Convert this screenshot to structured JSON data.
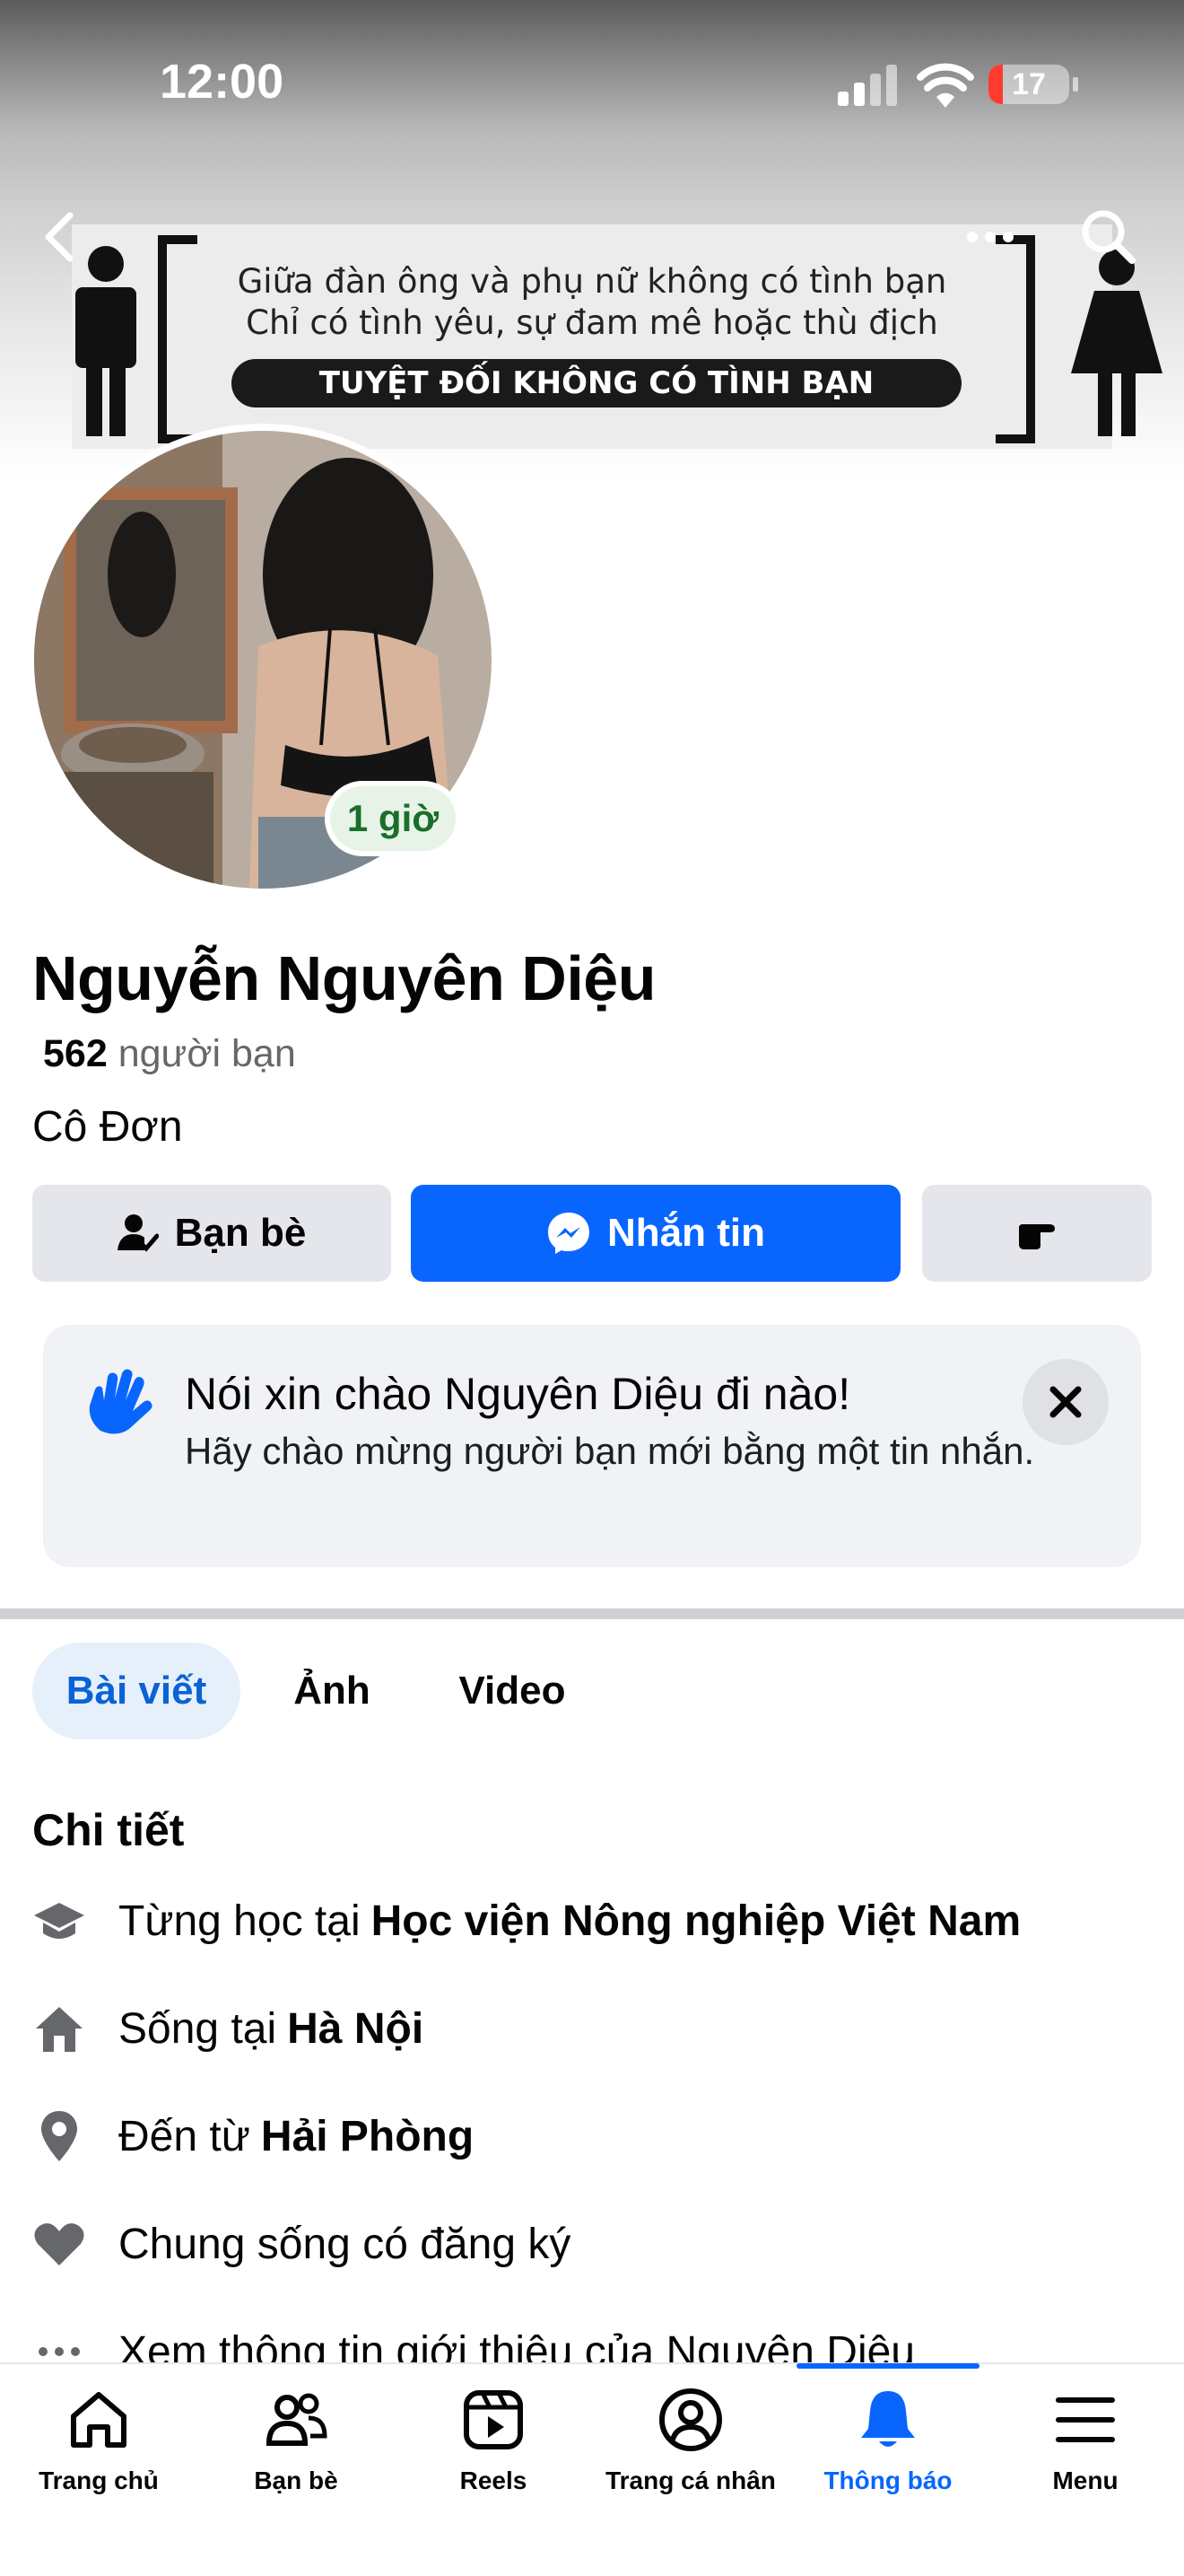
{
  "status_bar": {
    "time": "12:00",
    "battery": "17"
  },
  "cover": {
    "line1": "Giữa đàn ông và phụ nữ không có tình bạn",
    "line2": "Chỉ có tình yêu, sự đam mê hoặc thù địch",
    "banner": "TUYỆT ĐỐI KHÔNG CÓ TÌNH BẠN"
  },
  "profile": {
    "name": "Nguyễn Nguyên Diệu",
    "friend_count": "562",
    "friend_label": "người bạn",
    "bio": "Cô Đơn",
    "story_badge": "1 giờ"
  },
  "actions": {
    "friends": "Bạn bè",
    "message": "Nhắn tin"
  },
  "hello_card": {
    "title": "Nói xin chào Nguyên Diệu đi nào!",
    "subtitle": "Hãy chào mừng người bạn mới bằng một tin nhắn."
  },
  "tabs": [
    {
      "label": "Bài viết"
    },
    {
      "label": "Ảnh"
    },
    {
      "label": "Video"
    }
  ],
  "details": {
    "heading": "Chi tiết",
    "items": [
      {
        "prefix": "Từng học tại",
        "value": "Học viện Nông nghiệp Việt Nam",
        "icon": "graduation-cap-icon"
      },
      {
        "prefix": "Sống tại",
        "value": "Hà Nội",
        "icon": "home-icon"
      },
      {
        "prefix": "Đến từ",
        "value": "Hải Phòng",
        "icon": "location-pin-icon"
      },
      {
        "prefix": "Chung sống có đăng ký",
        "value": "",
        "icon": "heart-icon"
      },
      {
        "prefix": "Xem thông tin giới thiệu của Nguyên Diệu",
        "value": "",
        "icon": "more-dots-icon"
      }
    ]
  },
  "bottom_nav": [
    {
      "label": "Trang chủ",
      "icon": "home-icon"
    },
    {
      "label": "Bạn bè",
      "icon": "friends-icon"
    },
    {
      "label": "Reels",
      "icon": "reels-icon"
    },
    {
      "label": "Trang cá nhân",
      "icon": "profile-icon"
    },
    {
      "label": "Thông báo",
      "icon": "bell-icon",
      "active": true
    },
    {
      "label": "Menu",
      "icon": "menu-icon"
    }
  ],
  "colors": {
    "accent": "#0866ff",
    "badge_green": "#1b6e2a"
  }
}
